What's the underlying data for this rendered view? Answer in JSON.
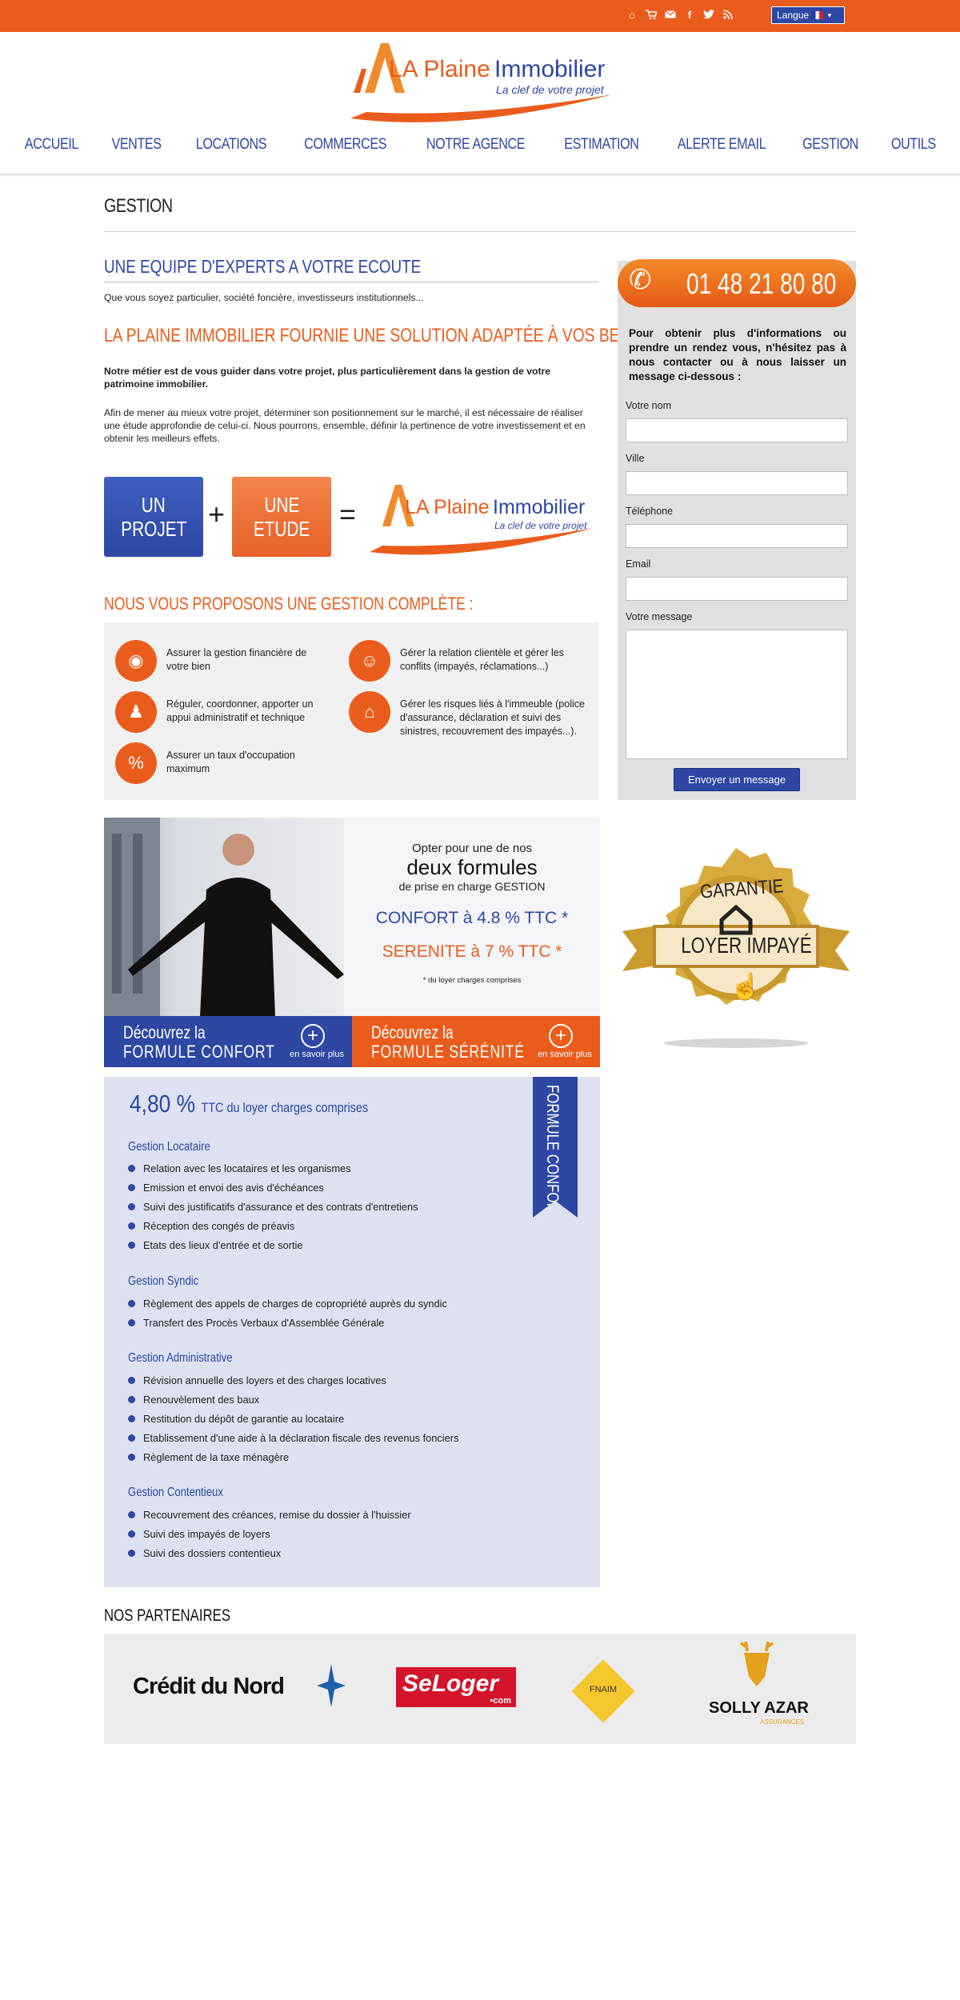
{
  "topbar": {
    "icons": [
      "home-icon",
      "cart-icon",
      "mail-icon",
      "facebook-icon",
      "twitter-icon",
      "rss-icon"
    ],
    "langue_label": "Langue"
  },
  "logo": {
    "name_part1": "LA Plaine",
    "name_part2": "Immobilier",
    "tagline": "La clef de votre projet"
  },
  "nav": {
    "items": [
      "ACCUEIL",
      "VENTES",
      "LOCATIONS",
      "COMMERCES",
      "NOTRE AGENCE",
      "ESTIMATION",
      "ALERTE EMAIL",
      "GESTION",
      "OUTILS"
    ]
  },
  "page": {
    "title": "GESTION",
    "h_experts": "UNE EQUIPE D'EXPERTS A VOTRE ECOUTE",
    "intro": "Que vous soyez particulier, société foncière, investisseurs institutionnels...",
    "h_solution": "LA PLAINE IMMOBILIER FOURNIE UNE SOLUTION ADAPTÉE À VOS BESOINS.",
    "para1": "Notre métier est de vous guider dans votre projet, plus particulièrement dans la gestion de votre patrimoine immobilier.",
    "para2": "Afin de mener au mieux votre projet, déterminer son positionnement sur le marché, il est nécessaire de réaliser une étude approfondie de celui-ci. Nous pourrons, ensemble, définir la pertinence de votre investissement et en obtenir les meilleurs effets.",
    "equation": {
      "box1_l1": "UN",
      "box1_l2": "PROJET",
      "plus": "+",
      "box2_l1": "UNE",
      "box2_l2": "ETUDE",
      "equals": "="
    },
    "h_gestion": "NOUS VOUS PROPOSONS UNE GESTION COMPLÈTE :",
    "gestion_items": [
      "Assurer la gestion financière de votre bien",
      "Réguler, coordonner, apporter un appui administratif et technique",
      "Assurer un taux d'occupation maximum",
      "Gérer la relation clientèle et gérer les conflits (impayés, réclamations...)",
      "Gérer les risques liés à l'immeuble (police d'assurance, déclaration et suivi des sinistres, recouvrement des impayés...)."
    ]
  },
  "contact": {
    "phone": "01 48 21 80 80",
    "intro": "Pour obtenir plus d'informations ou prendre un rendez vous, n'hésitez pas à nous contacter ou à nous laisser un message ci-dessous :",
    "labels": {
      "nom": "Votre nom",
      "ville": "Ville",
      "tel": "Téléphone",
      "email": "Email",
      "message": "Votre message"
    },
    "send": "Envoyer un message"
  },
  "badge": {
    "top": "GARANTIE",
    "bottom": "LOYER IMPAYÉ"
  },
  "promo": {
    "line1": "Opter pour une de nos",
    "line2": "deux formules",
    "line3": "de prise en charge GESTION",
    "confort": "CONFORT à 4.8 % TTC *",
    "serenite": "SERENITE à 7 % TTC *",
    "note": "* du loyer charges comprises",
    "btn_confort": {
      "l1": "Découvrez la",
      "l2": "FORMULE CONFORT",
      "more": "en savoir plus"
    },
    "btn_serenite": {
      "l1": "Découvrez la",
      "l2": "FORMULE SÉRÉNITÉ",
      "more": "en savoir plus"
    }
  },
  "confort": {
    "ribbon": "FORMULE CONFORT",
    "rate": "4,80 %",
    "rate_suffix": "TTC du loyer charges comprises",
    "sections": [
      {
        "title": "Gestion Locataire",
        "items": [
          "Relation avec les locataires et les organismes",
          "Emission et envoi des avis d'échéances",
          "Suivi des justificatifs d'assurance et des contrats d'entretiens",
          "Réception des congés de préavis",
          "Etats des lieux d'entrée et de sortie"
        ]
      },
      {
        "title": "Gestion Syndic",
        "items": [
          "Règlement des appels de charges de copropriété auprès du syndic",
          "Transfert des Procès Verbaux d'Assemblée Générale"
        ]
      },
      {
        "title": "Gestion Administrative",
        "items": [
          "Révision annuelle des loyers et des charges locatives",
          "Renouvèlement des baux",
          "Restitution du dépôt de garantie au locataire",
          "Etablissement d'une aide à la déclaration fiscale des revenus fonciers",
          "Règlement de la taxe ménagère"
        ]
      },
      {
        "title": "Gestion Contentieux",
        "items": [
          "Recouvrement des créances, remise du dossier à l'huissier",
          "Suivi des impayés de loyers",
          "Suivi des dossiers contentieux"
        ]
      }
    ]
  },
  "partners": {
    "title": "NOS PARTENAIRES",
    "logos": {
      "credit": "Crédit du Nord",
      "seloger1": "SeLoger",
      "seloger2": "•com",
      "fnaim": "FNAIM",
      "solly1": "SOLLY AZAR",
      "solly2": "ASSURANCES"
    }
  },
  "colors": {
    "orange": "#ea5c1c",
    "blue": "#2d47a3",
    "gold": "#d8ac3c"
  }
}
